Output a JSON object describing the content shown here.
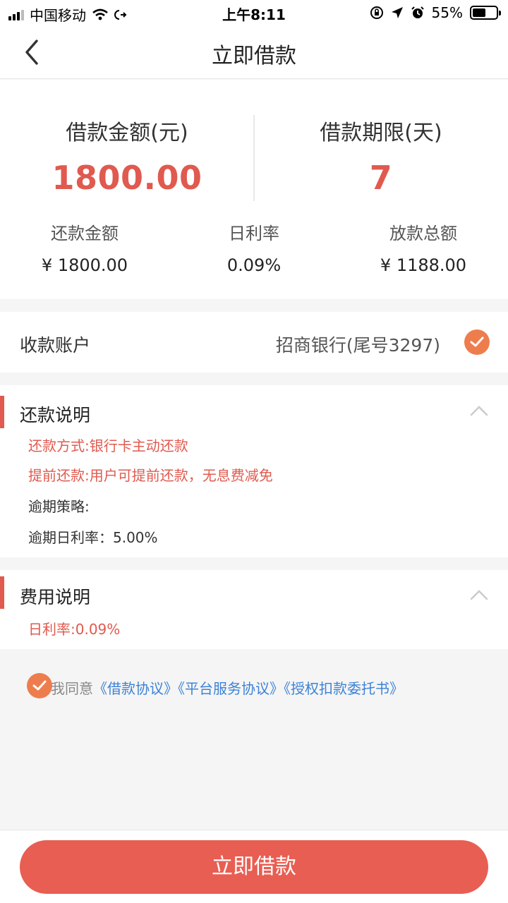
{
  "status_bar": {
    "carrier": "中国移动",
    "time": "上午8:11",
    "battery": "55%",
    "battery_level": 0.55
  },
  "nav": {
    "title": "立即借款"
  },
  "summary": {
    "amount_label": "借款金额(元)",
    "amount_value": "1800.00",
    "term_label": "借款期限(天)",
    "term_value": "7",
    "repay_label": "还款金额",
    "repay_value": "¥ 1800.00",
    "rate_label": "日利率",
    "rate_value": "0.09%",
    "disburse_label": "放款总额",
    "disburse_value": "¥ 1188.00"
  },
  "account": {
    "label": "收款账户",
    "value": "招商银行(尾号3297)"
  },
  "repayment_section": {
    "title": "还款说明",
    "lines": [
      "还款方式:银行卡主动还款",
      "提前还款:用户可提前还款，无息费减免",
      "逾期策略:",
      "逾期日利率：5.00%"
    ]
  },
  "fee_section": {
    "title": "费用说明",
    "lines": [
      "日利率:0.09%"
    ]
  },
  "agreement": {
    "text": "我同意",
    "links": [
      "《借款协议》",
      "《平台服务协议》",
      "《授权扣款委托书》"
    ]
  },
  "footer": {
    "button_label": "立即借款"
  },
  "colors": {
    "accent_red": "#e05a4f",
    "check_orange": "#ee7d4e",
    "link_blue": "#3c82d6",
    "button_red": "#e85e52"
  }
}
